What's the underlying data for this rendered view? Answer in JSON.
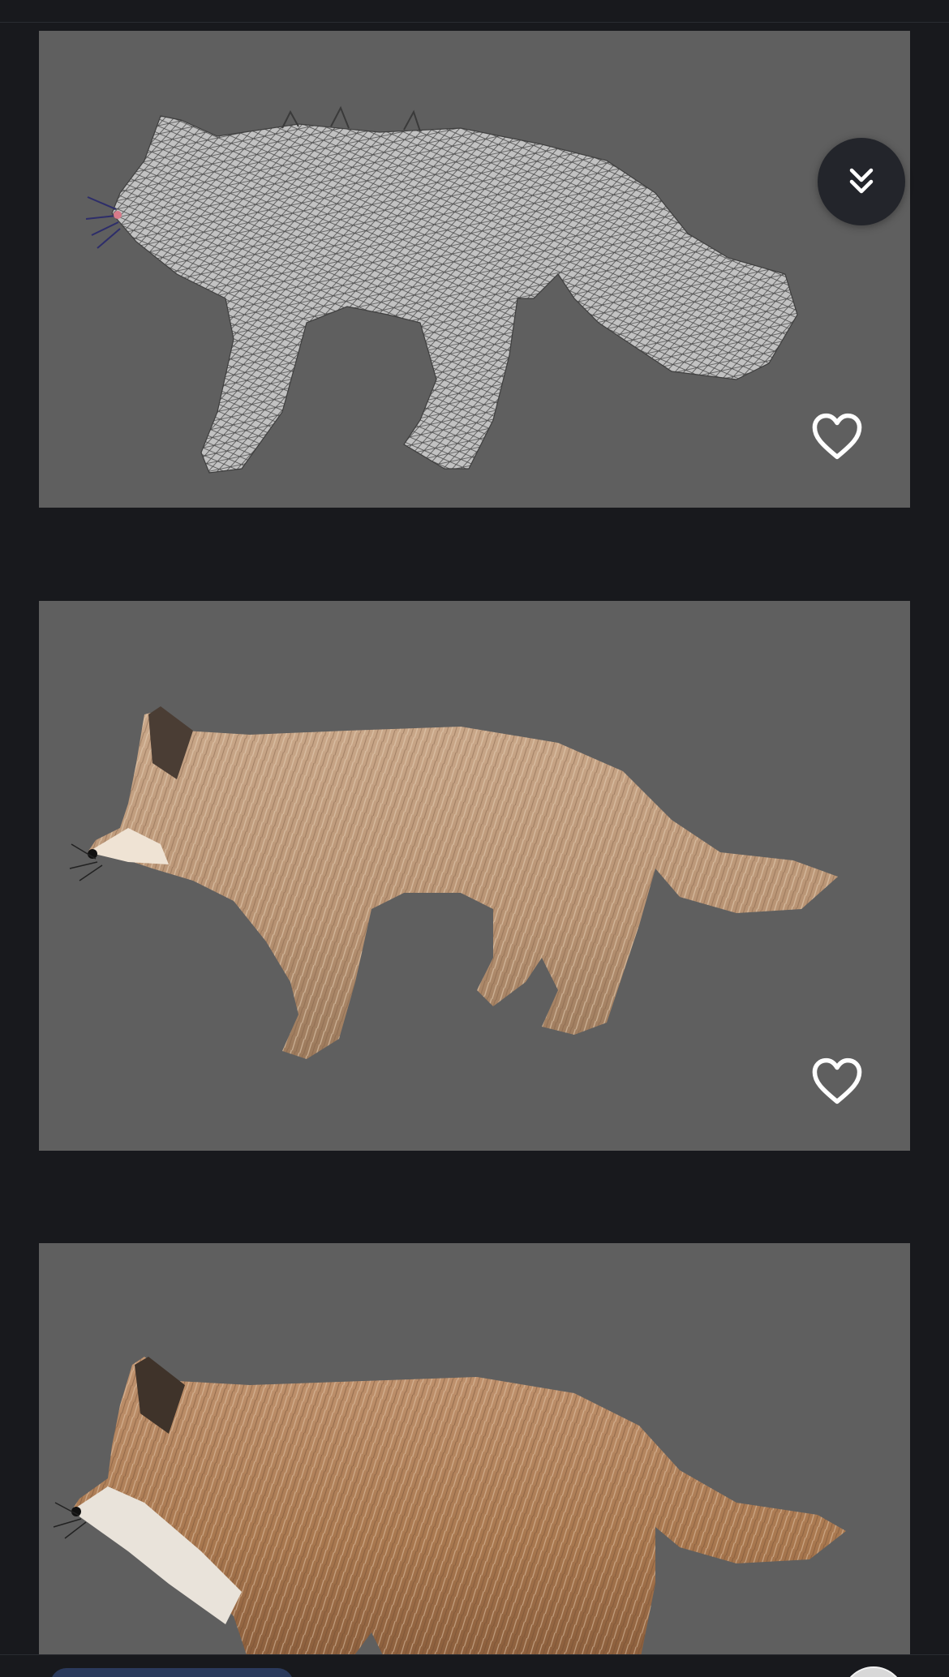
{
  "gallery": {
    "images": [
      {
        "alt": "",
        "favorited": false
      },
      {
        "alt": "",
        "favorited": false
      },
      {
        "alt": "",
        "favorited": false
      }
    ]
  },
  "icons": {
    "favorite": "heart-outline-icon",
    "scroll_down": "double-chevron-down-icon"
  },
  "colors": {
    "page_background": "#18191d",
    "card_background": "#5f5f5f",
    "floating_button": "#23252b",
    "icon": "#ffffff",
    "fur_light": "#e9d3b6",
    "fur_mid": "#b48f6c",
    "fur_dark": "#8a6647"
  }
}
